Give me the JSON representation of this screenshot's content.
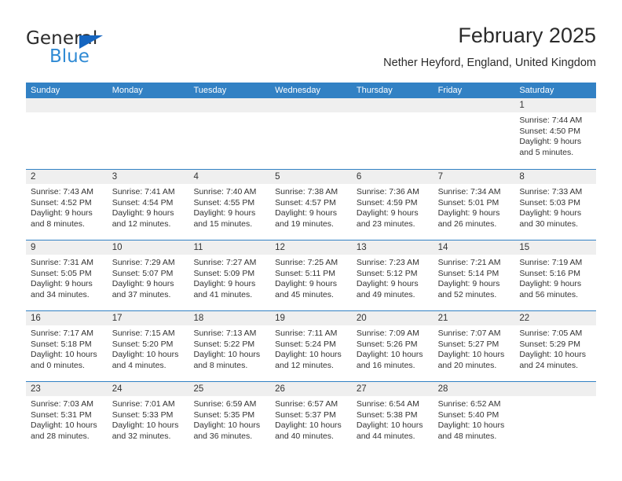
{
  "brand": {
    "name_part1": "General",
    "name_part2": "Blue",
    "accent_color": "#2f8ad4",
    "triangle_color": "#1565c0"
  },
  "header": {
    "title": "February 2025",
    "subtitle": "Nether Heyford, England, United Kingdom"
  },
  "calendar": {
    "header_bg": "#3281c4",
    "daynum_bg": "#efefef",
    "weekdays": [
      "Sunday",
      "Monday",
      "Tuesday",
      "Wednesday",
      "Thursday",
      "Friday",
      "Saturday"
    ],
    "weeks": [
      [
        {
          "day": "",
          "empty": true
        },
        {
          "day": "",
          "empty": true
        },
        {
          "day": "",
          "empty": true
        },
        {
          "day": "",
          "empty": true
        },
        {
          "day": "",
          "empty": true
        },
        {
          "day": "",
          "empty": true
        },
        {
          "day": "1",
          "sunrise": "Sunrise: 7:44 AM",
          "sunset": "Sunset: 4:50 PM",
          "daylight": "Daylight: 9 hours and 5 minutes."
        }
      ],
      [
        {
          "day": "2",
          "sunrise": "Sunrise: 7:43 AM",
          "sunset": "Sunset: 4:52 PM",
          "daylight": "Daylight: 9 hours and 8 minutes."
        },
        {
          "day": "3",
          "sunrise": "Sunrise: 7:41 AM",
          "sunset": "Sunset: 4:54 PM",
          "daylight": "Daylight: 9 hours and 12 minutes."
        },
        {
          "day": "4",
          "sunrise": "Sunrise: 7:40 AM",
          "sunset": "Sunset: 4:55 PM",
          "daylight": "Daylight: 9 hours and 15 minutes."
        },
        {
          "day": "5",
          "sunrise": "Sunrise: 7:38 AM",
          "sunset": "Sunset: 4:57 PM",
          "daylight": "Daylight: 9 hours and 19 minutes."
        },
        {
          "day": "6",
          "sunrise": "Sunrise: 7:36 AM",
          "sunset": "Sunset: 4:59 PM",
          "daylight": "Daylight: 9 hours and 23 minutes."
        },
        {
          "day": "7",
          "sunrise": "Sunrise: 7:34 AM",
          "sunset": "Sunset: 5:01 PM",
          "daylight": "Daylight: 9 hours and 26 minutes."
        },
        {
          "day": "8",
          "sunrise": "Sunrise: 7:33 AM",
          "sunset": "Sunset: 5:03 PM",
          "daylight": "Daylight: 9 hours and 30 minutes."
        }
      ],
      [
        {
          "day": "9",
          "sunrise": "Sunrise: 7:31 AM",
          "sunset": "Sunset: 5:05 PM",
          "daylight": "Daylight: 9 hours and 34 minutes."
        },
        {
          "day": "10",
          "sunrise": "Sunrise: 7:29 AM",
          "sunset": "Sunset: 5:07 PM",
          "daylight": "Daylight: 9 hours and 37 minutes."
        },
        {
          "day": "11",
          "sunrise": "Sunrise: 7:27 AM",
          "sunset": "Sunset: 5:09 PM",
          "daylight": "Daylight: 9 hours and 41 minutes."
        },
        {
          "day": "12",
          "sunrise": "Sunrise: 7:25 AM",
          "sunset": "Sunset: 5:11 PM",
          "daylight": "Daylight: 9 hours and 45 minutes."
        },
        {
          "day": "13",
          "sunrise": "Sunrise: 7:23 AM",
          "sunset": "Sunset: 5:12 PM",
          "daylight": "Daylight: 9 hours and 49 minutes."
        },
        {
          "day": "14",
          "sunrise": "Sunrise: 7:21 AM",
          "sunset": "Sunset: 5:14 PM",
          "daylight": "Daylight: 9 hours and 52 minutes."
        },
        {
          "day": "15",
          "sunrise": "Sunrise: 7:19 AM",
          "sunset": "Sunset: 5:16 PM",
          "daylight": "Daylight: 9 hours and 56 minutes."
        }
      ],
      [
        {
          "day": "16",
          "sunrise": "Sunrise: 7:17 AM",
          "sunset": "Sunset: 5:18 PM",
          "daylight": "Daylight: 10 hours and 0 minutes."
        },
        {
          "day": "17",
          "sunrise": "Sunrise: 7:15 AM",
          "sunset": "Sunset: 5:20 PM",
          "daylight": "Daylight: 10 hours and 4 minutes."
        },
        {
          "day": "18",
          "sunrise": "Sunrise: 7:13 AM",
          "sunset": "Sunset: 5:22 PM",
          "daylight": "Daylight: 10 hours and 8 minutes."
        },
        {
          "day": "19",
          "sunrise": "Sunrise: 7:11 AM",
          "sunset": "Sunset: 5:24 PM",
          "daylight": "Daylight: 10 hours and 12 minutes."
        },
        {
          "day": "20",
          "sunrise": "Sunrise: 7:09 AM",
          "sunset": "Sunset: 5:26 PM",
          "daylight": "Daylight: 10 hours and 16 minutes."
        },
        {
          "day": "21",
          "sunrise": "Sunrise: 7:07 AM",
          "sunset": "Sunset: 5:27 PM",
          "daylight": "Daylight: 10 hours and 20 minutes."
        },
        {
          "day": "22",
          "sunrise": "Sunrise: 7:05 AM",
          "sunset": "Sunset: 5:29 PM",
          "daylight": "Daylight: 10 hours and 24 minutes."
        }
      ],
      [
        {
          "day": "23",
          "sunrise": "Sunrise: 7:03 AM",
          "sunset": "Sunset: 5:31 PM",
          "daylight": "Daylight: 10 hours and 28 minutes."
        },
        {
          "day": "24",
          "sunrise": "Sunrise: 7:01 AM",
          "sunset": "Sunset: 5:33 PM",
          "daylight": "Daylight: 10 hours and 32 minutes."
        },
        {
          "day": "25",
          "sunrise": "Sunrise: 6:59 AM",
          "sunset": "Sunset: 5:35 PM",
          "daylight": "Daylight: 10 hours and 36 minutes."
        },
        {
          "day": "26",
          "sunrise": "Sunrise: 6:57 AM",
          "sunset": "Sunset: 5:37 PM",
          "daylight": "Daylight: 10 hours and 40 minutes."
        },
        {
          "day": "27",
          "sunrise": "Sunrise: 6:54 AM",
          "sunset": "Sunset: 5:38 PM",
          "daylight": "Daylight: 10 hours and 44 minutes."
        },
        {
          "day": "28",
          "sunrise": "Sunrise: 6:52 AM",
          "sunset": "Sunset: 5:40 PM",
          "daylight": "Daylight: 10 hours and 48 minutes."
        },
        {
          "day": "",
          "empty": true
        }
      ]
    ]
  }
}
